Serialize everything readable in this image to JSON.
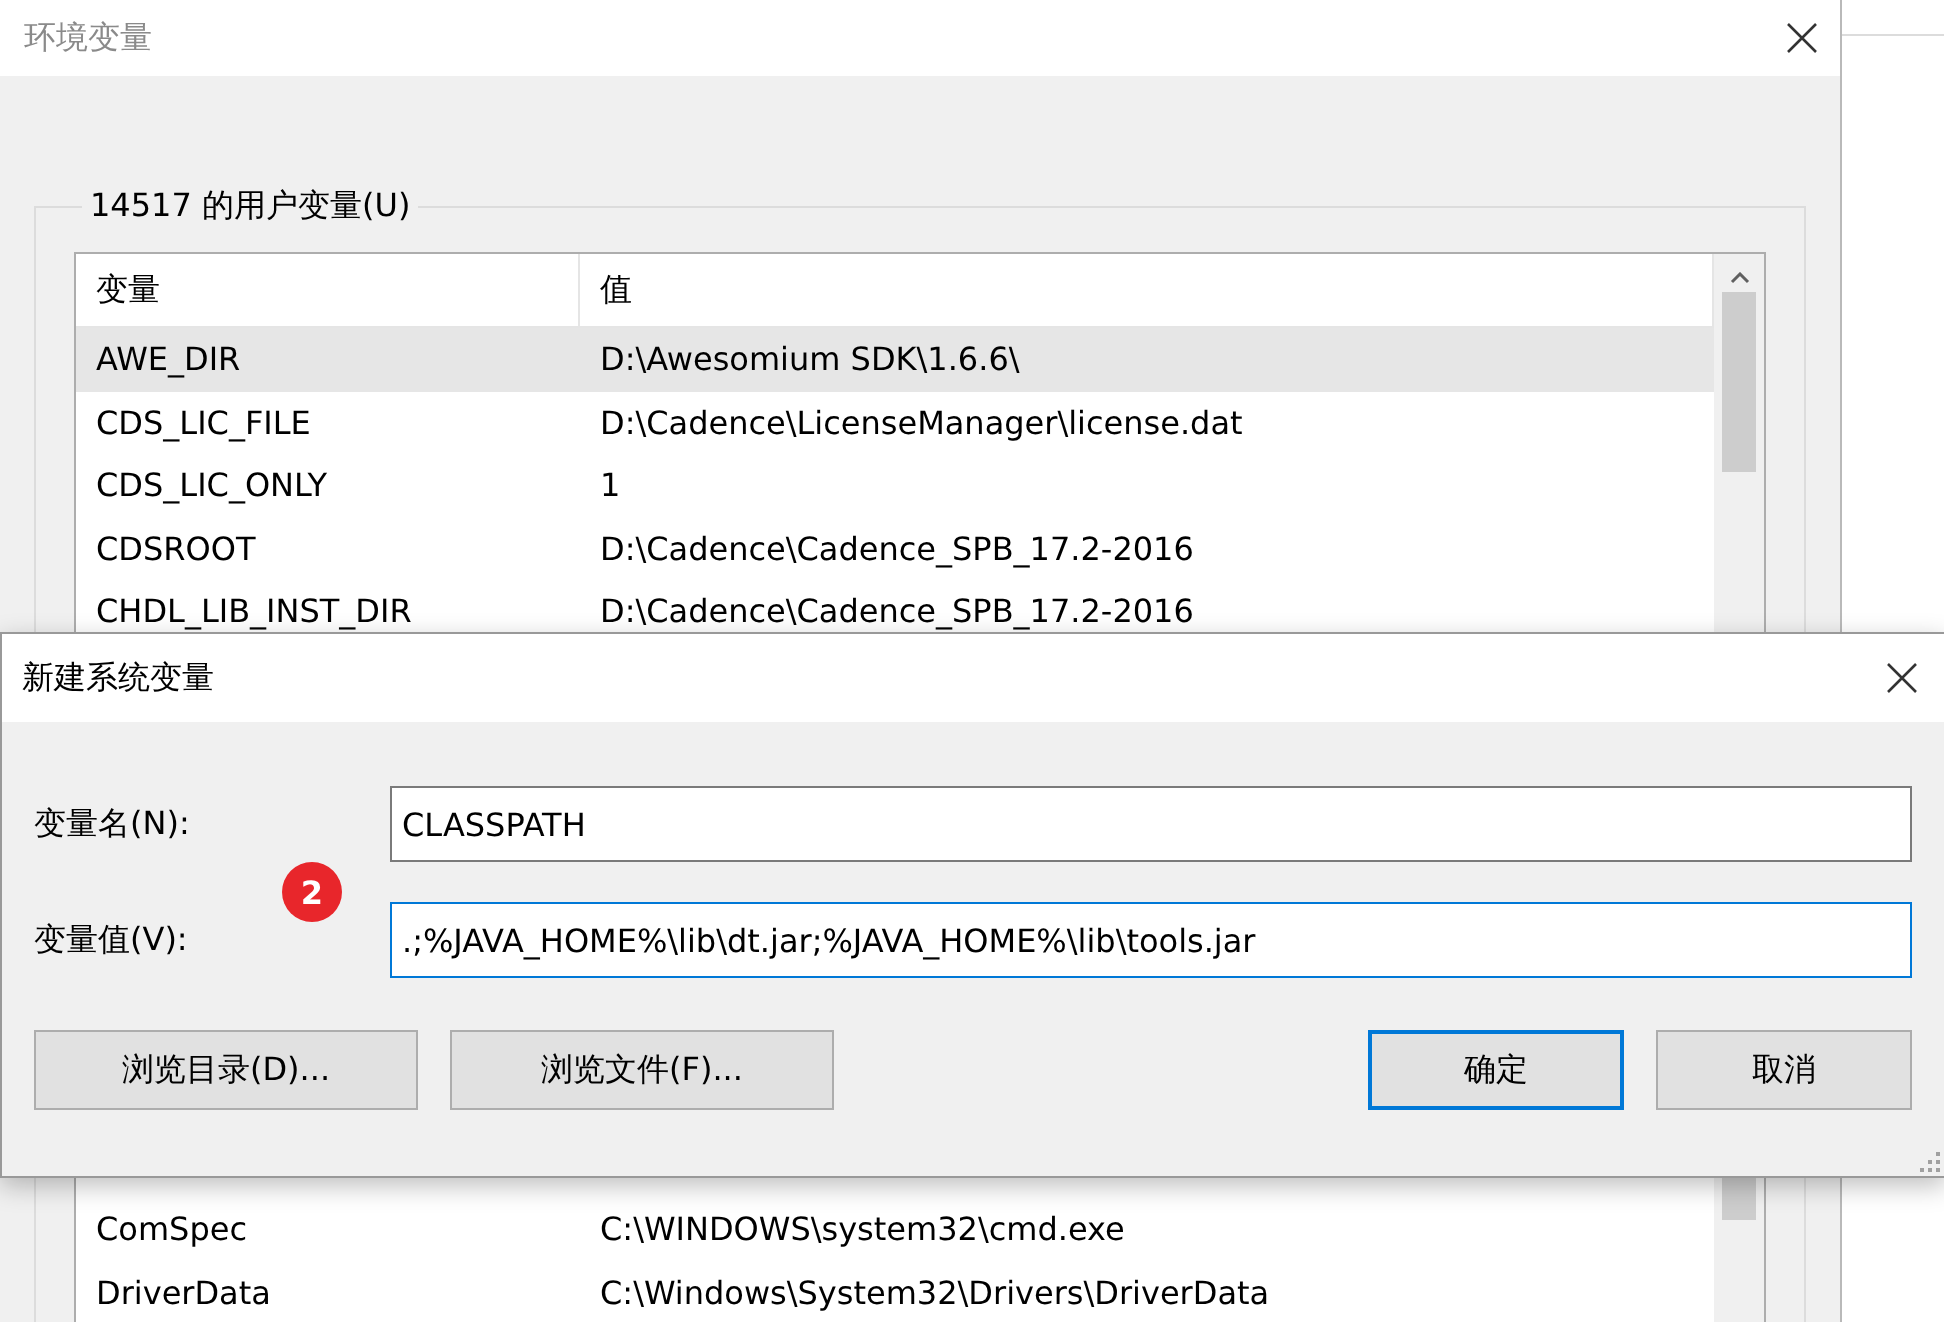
{
  "background_window": {
    "title": "环境变量",
    "user_variables": {
      "label": "14517 的用户变量(U)",
      "columns": [
        "变量",
        "值"
      ],
      "rows": [
        {
          "name": "AWE_DIR",
          "value": "D:\\Awesomium SDK\\1.6.6\\",
          "selected": true
        },
        {
          "name": "CDS_LIC_FILE",
          "value": "D:\\Cadence\\LicenseManager\\license.dat",
          "selected": false
        },
        {
          "name": "CDS_LIC_ONLY",
          "value": "1",
          "selected": false
        },
        {
          "name": "CDSROOT",
          "value": "D:\\Cadence\\Cadence_SPB_17.2-2016",
          "selected": false
        },
        {
          "name": "CHDL_LIB_INST_DIR",
          "value": "D:\\Cadence\\Cadence_SPB_17.2-2016",
          "selected": false
        }
      ]
    },
    "system_variables": {
      "rows": [
        {
          "name": "ComSpec",
          "value": "C:\\WINDOWS\\system32\\cmd.exe",
          "selected": false
        },
        {
          "name": "DriverData",
          "value": "C:\\Windows\\System32\\Drivers\\DriverData",
          "selected": false
        }
      ]
    }
  },
  "dialog": {
    "title": "新建系统变量",
    "badge": "2",
    "fields": [
      {
        "label": "变量名(N):",
        "value": "CLASSPATH",
        "focused": false
      },
      {
        "label": "变量值(V):",
        "value": ".;%JAVA_HOME%\\lib\\dt.jar;%JAVA_HOME%\\lib\\tools.jar",
        "focused": true
      }
    ],
    "buttons": [
      {
        "label": "浏览目录(D)...",
        "default": false
      },
      {
        "label": "浏览文件(F)...",
        "default": false
      },
      {
        "label": "确定",
        "default": true
      },
      {
        "label": "取消",
        "default": false
      }
    ]
  }
}
